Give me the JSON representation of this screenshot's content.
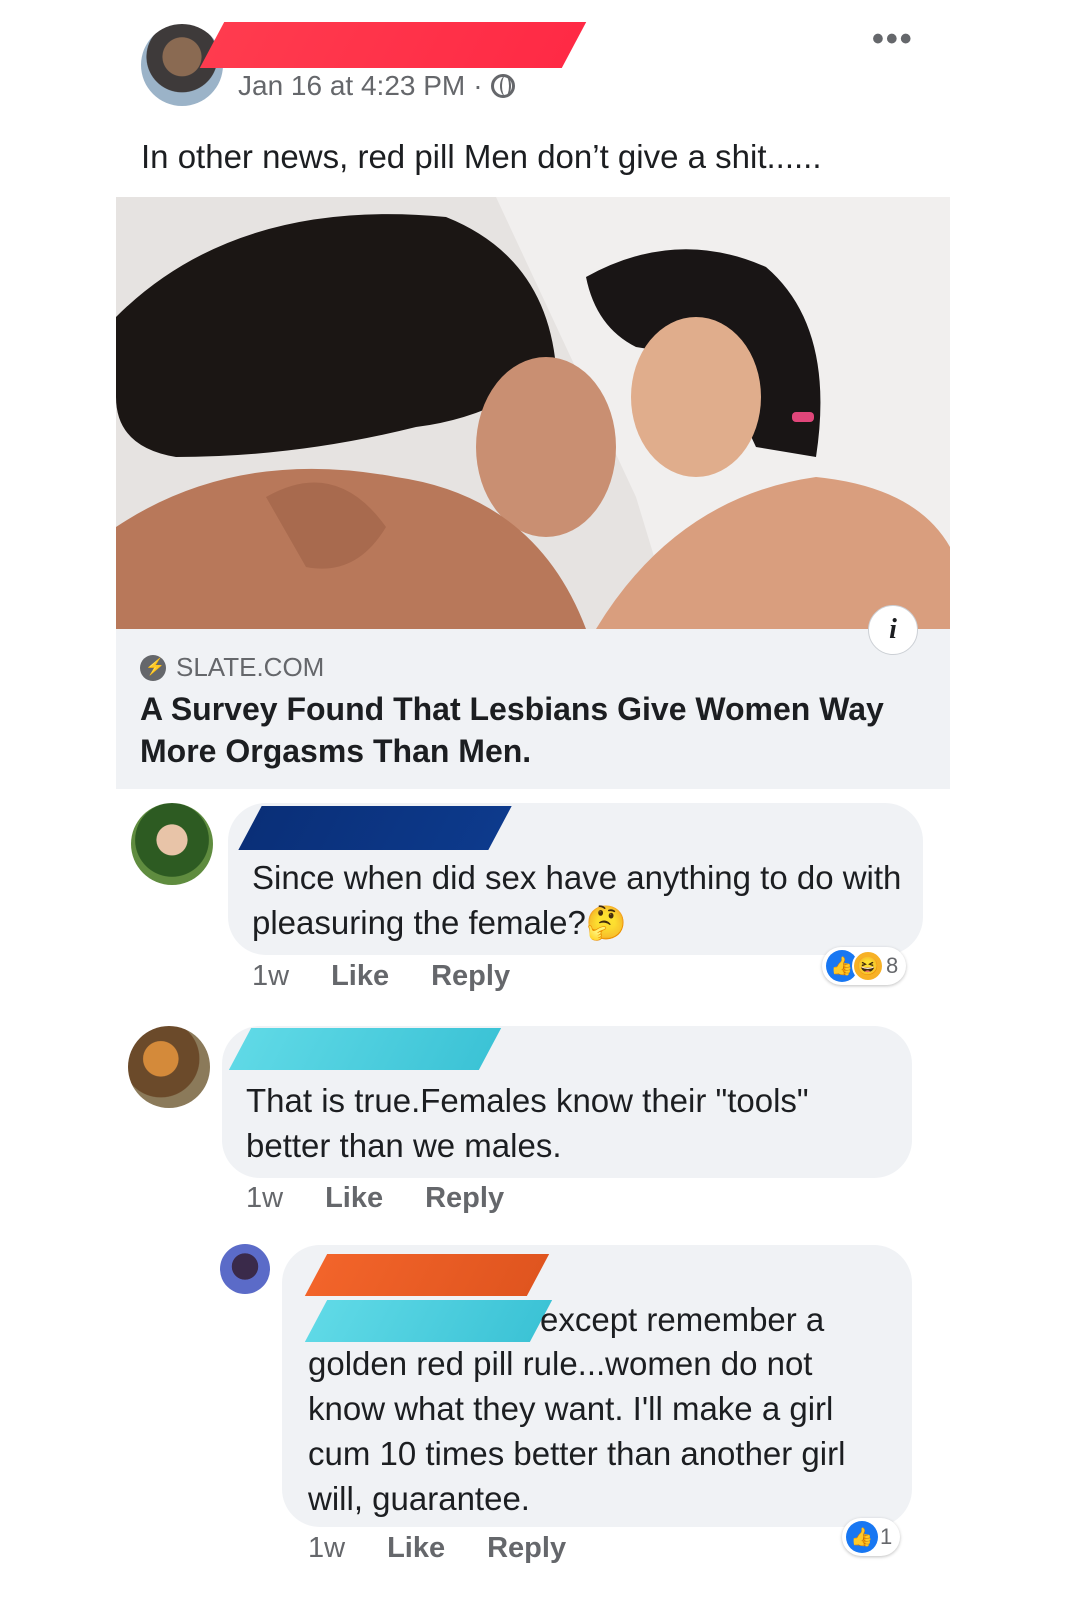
{
  "post": {
    "timestamp": "Jan 16 at 4:23 PM",
    "separator": "·",
    "privacy_icon": "globe-icon",
    "more_icon": "more-dots-icon",
    "more_label": "•••",
    "text": "In other news, red pill Men don’t give a shit......"
  },
  "link": {
    "domain": "SLATE.COM",
    "title": "A Survey Found That Lesbians Give Women Way More Orgasms Than Men.",
    "info_label": "i"
  },
  "comments": [
    {
      "text": "Since when did sex have anything to do with pleasuring the female?🤔",
      "time": "1w",
      "like": "Like",
      "reply": "Reply",
      "reaction_count": "8"
    },
    {
      "text": "That is true.Females know their \"tools\" better than we males.",
      "time": "1w",
      "like": "Like",
      "reply": "Reply"
    },
    {
      "text_line1": "except remember a",
      "text_rest": "golden red pill rule...women do not know what they want.  I'll make a girl cum 10 times better than another girl will, guarantee.",
      "time": "1w",
      "like": "Like",
      "reply": "Reply",
      "reaction_count": "1"
    }
  ],
  "colors": {
    "redaction_red": "#ff2a45",
    "redaction_navy": "#0d3a8c",
    "redaction_cyan": "#4fcfe0",
    "redaction_orange": "#f2642a",
    "facebook_blue": "#1877f2"
  }
}
